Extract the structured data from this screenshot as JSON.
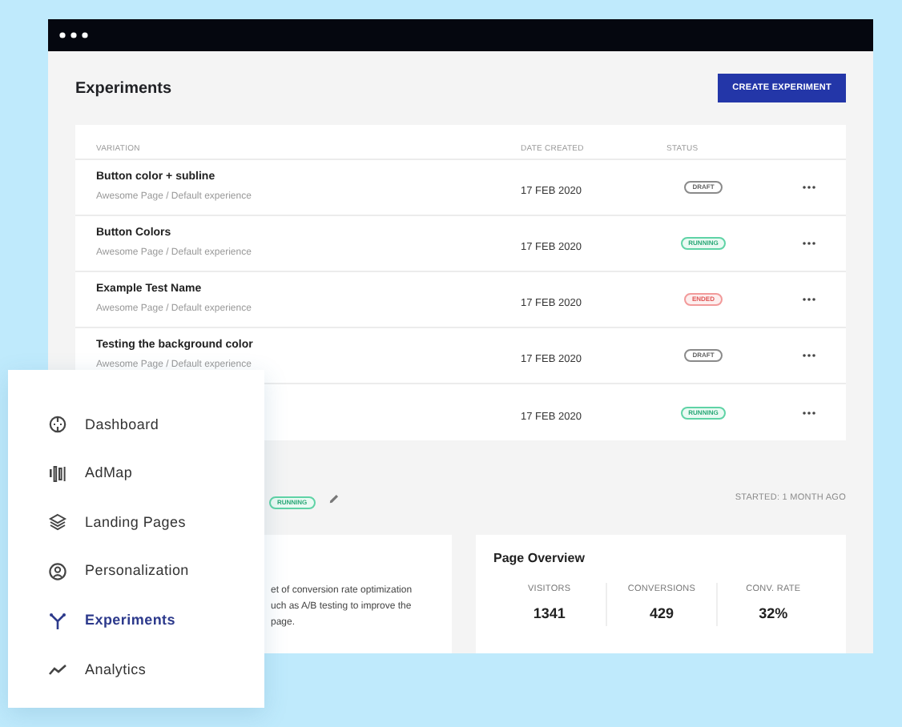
{
  "page_title": "Experiments",
  "create_button": "CREATE EXPERIMENT",
  "table": {
    "columns": [
      "VARIATION",
      "DATE CREATED",
      "STATUS"
    ],
    "rows": [
      {
        "name": "Button color + subline",
        "path": "Awesome Page / Default experience",
        "date": "17 FEB 2020",
        "status": {
          "label": "DRAFT",
          "kind": "draft"
        }
      },
      {
        "name": "Button Colors",
        "path": "Awesome Page / Default experience",
        "date": "17 FEB 2020",
        "status": {
          "label": "RUNNING",
          "kind": "running"
        }
      },
      {
        "name": "Example Test Name",
        "path": "Awesome Page / Default experience",
        "date": "17 FEB 2020",
        "status": {
          "label": "ENDED",
          "kind": "ended"
        }
      },
      {
        "name": "Testing the background color",
        "path": "Awesome Page / Default experience",
        "date": "17 FEB 2020",
        "status": {
          "label": "DRAFT",
          "kind": "draft"
        }
      },
      {
        "date": "17 FEB 2020",
        "status": {
          "label": "RUNNING",
          "kind": "running"
        }
      }
    ]
  },
  "detail": {
    "status": {
      "label": "RUNNING",
      "kind": "running"
    },
    "started": "STARTED: 1 MONTH AGO",
    "description_lines": [
      "et of conversion rate optimization",
      "uch as A/B testing to improve the",
      "page."
    ],
    "overview": {
      "title": "Page Overview",
      "metrics": [
        {
          "label": "VISITORS",
          "value": "1341"
        },
        {
          "label": "CONVERSIONS",
          "value": "429"
        },
        {
          "label": "CONV. RATE",
          "value": "32%"
        }
      ]
    }
  },
  "sidebar": {
    "items": [
      {
        "label": "Dashboard",
        "selected": false
      },
      {
        "label": "AdMap",
        "selected": false
      },
      {
        "label": "Landing Pages",
        "selected": false
      },
      {
        "label": "Personalization",
        "selected": false
      },
      {
        "label": "Experiments",
        "selected": true
      },
      {
        "label": "Analytics",
        "selected": false
      }
    ]
  }
}
